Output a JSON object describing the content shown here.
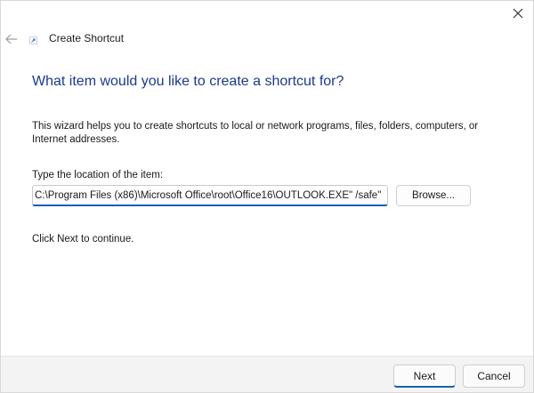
{
  "window": {
    "title": "Create Shortcut"
  },
  "content": {
    "heading": "What item would you like to create a shortcut for?",
    "description": "This wizard helps you to create shortcuts to local or network programs, files, folders, computers, or Internet addresses.",
    "location_label": "Type the location of the item:",
    "location_value": "\"C:\\Program Files (x86)\\Microsoft Office\\root\\Office16\\OUTLOOK.EXE\" /safe",
    "browse_label": "Browse...",
    "continue_text": "Click Next to continue."
  },
  "footer": {
    "next_label": "Next",
    "cancel_label": "Cancel"
  },
  "icons": {
    "close": "close-icon",
    "back": "back-arrow-icon",
    "app": "shortcut-icon"
  },
  "colors": {
    "heading": "#1a3a8c",
    "accent": "#1a5fb4",
    "footer_bg": "#f3f3f3"
  }
}
